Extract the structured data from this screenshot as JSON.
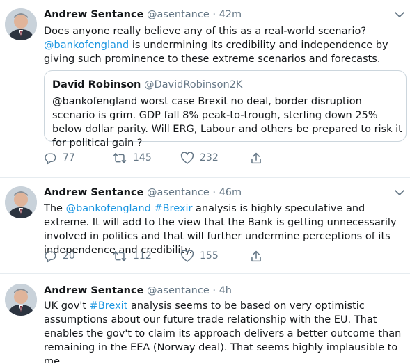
{
  "tweets": [
    {
      "name": "Andrew Sentance",
      "handle": "@asentance",
      "dot": "·",
      "time": "42m",
      "segments": [
        {
          "t": "Does anyone really believe any of this as a real-world scenario? "
        },
        {
          "t": "@bankofengland",
          "link": true
        },
        {
          "t": " is undermining its credibility and independence by giving such prominence to these extreme scenarios and forecasts."
        }
      ],
      "quote": {
        "name": "David Robinson",
        "handle": "@DavidRobinson2K",
        "text": "@bankofengland worst case Brexit no deal, border disruption scenario is grim. GDP fall 8% peak-to-trough, sterling down 25% below dollar parity. Will ERG, Labour and others be prepared to risk it for political gain ?"
      },
      "replies": "77",
      "retweets": "145",
      "likes": "232"
    },
    {
      "name": "Andrew Sentance",
      "handle": "@asentance",
      "dot": "·",
      "time": "46m",
      "segments": [
        {
          "t": "The "
        },
        {
          "t": "@bankofengland",
          "link": true
        },
        {
          "t": " "
        },
        {
          "t": "#Brexir",
          "link": true
        },
        {
          "t": " analysis is highly speculative and extreme. It will add to the view that the Bank is getting unnecessarily involved in politics and that will further undermine perceptions of its independence and credibility."
        }
      ],
      "replies": "20",
      "retweets": "112",
      "likes": "155"
    },
    {
      "name": "Andrew Sentance",
      "handle": "@asentance",
      "dot": "·",
      "time": "4h",
      "segments": [
        {
          "t": "UK gov't "
        },
        {
          "t": "#Brexit",
          "link": true
        },
        {
          "t": " analysis seems to be based on very optimistic assumptions about our future trade relationship with the EU. That enables the gov't to claim its approach delivers a better outcome than remaining in the EEA (Norway deal). That seems highly implausible to me."
        }
      ]
    }
  ],
  "icons": {
    "reply": "reply-icon",
    "retweet": "retweet-icon",
    "like": "heart-icon",
    "share": "share-icon",
    "menu": "chevron-down-icon"
  },
  "colors": {
    "text": "#14171a",
    "secondary": "#657786",
    "link": "#1b95e0",
    "border": "#e6ecf0"
  }
}
